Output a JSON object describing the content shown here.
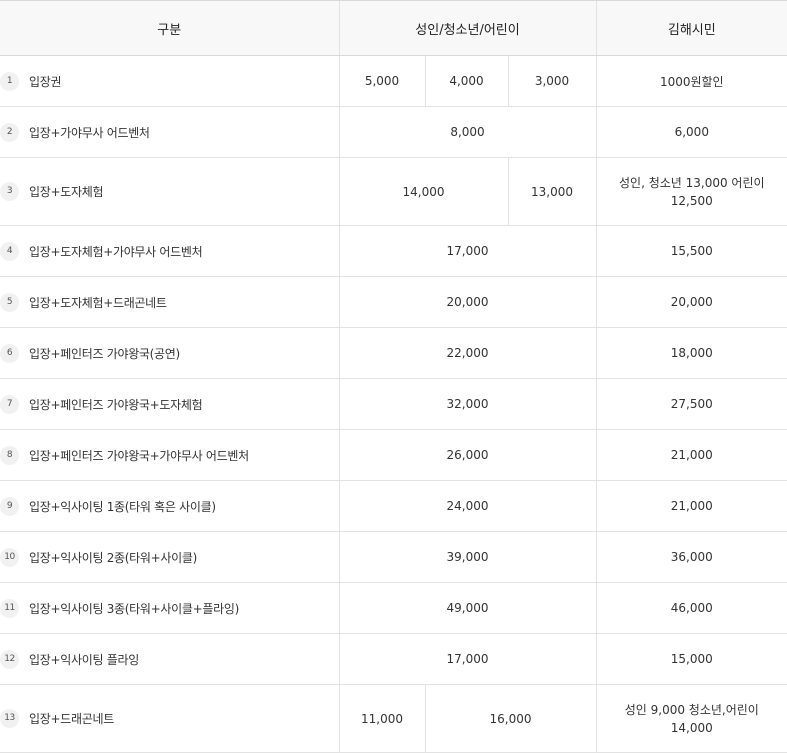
{
  "header": {
    "category": "구분",
    "adult_youth_child": "성인/청소년/어린이",
    "gimhae_citizen": "김해시민"
  },
  "rows": [
    {
      "no": "1",
      "name": "입장권",
      "adult": "5,000",
      "youth": "4,000",
      "child": "3,000",
      "citizen": "1000원할인"
    },
    {
      "no": "2",
      "name": "입장+가야무사 어드벤처",
      "price": "8,000",
      "citizen": "6,000"
    },
    {
      "no": "3",
      "name": "입장+도자체험",
      "adult_youth": "14,000",
      "child": "13,000",
      "citizen_line1": "성인, 청소년 13,000 어린이",
      "citizen_line2": "12,500"
    },
    {
      "no": "4",
      "name": "입장+도자체험+가야무사 어드벤처",
      "price": "17,000",
      "citizen": "15,500"
    },
    {
      "no": "5",
      "name": "입장+도자체험+드래곤네트",
      "price": "20,000",
      "citizen": "20,000"
    },
    {
      "no": "6",
      "name": "입장+페인터즈 가야왕국(공연)",
      "price": "22,000",
      "citizen": "18,000"
    },
    {
      "no": "7",
      "name": "입장+페인터즈 가야왕국+도자체험",
      "price": "32,000",
      "citizen": "27,500"
    },
    {
      "no": "8",
      "name": "입장+페인터즈 가야왕국+가야무사 어드벤처",
      "price": "26,000",
      "citizen": "21,000"
    },
    {
      "no": "9",
      "name": "입장+익사이팅 1종(타워 혹은 사이클)",
      "price": "24,000",
      "citizen": "21,000"
    },
    {
      "no": "10",
      "name": "입장+익사이팅 2종(타워+사이클)",
      "price": "39,000",
      "citizen": "36,000"
    },
    {
      "no": "11",
      "name": "입장+익사이팅 3종(타워+사이클+플라잉)",
      "price": "49,000",
      "citizen": "46,000"
    },
    {
      "no": "12",
      "name": "입장+익사이팅 플라잉",
      "price": "17,000",
      "citizen": "15,000"
    },
    {
      "no": "13",
      "name": "입장+드래곤네트",
      "adult": "11,000",
      "youth_child": "16,000",
      "citizen_line1": "성인 9,000 청소년,어린이",
      "citizen_line2": "14,000"
    }
  ]
}
